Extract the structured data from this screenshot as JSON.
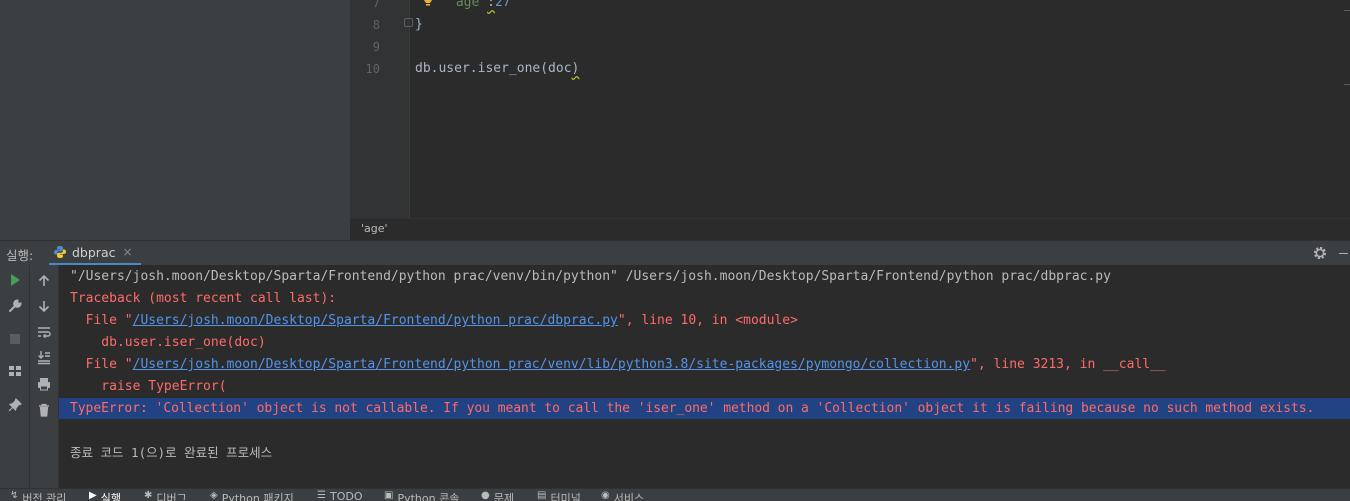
{
  "editor": {
    "lines": [
      {
        "num": "7",
        "code_key": "'age'",
        "code_sep": ":",
        "code_val": "27"
      },
      {
        "num": "8",
        "code": "}"
      },
      {
        "num": "9",
        "code": ""
      },
      {
        "num": "10",
        "code_prefix": "db.user.iser_one(doc",
        "code_suffix": ")"
      }
    ],
    "breadcrumb": "'age'"
  },
  "run_panel": {
    "label": "실행:",
    "tab_name": "dbprac",
    "tab_close": "×",
    "console": {
      "cmd_line": "\"/Users/josh.moon/Desktop/Sparta/Frontend/python prac/venv/bin/python\" /Users/josh.moon/Desktop/Sparta/Frontend/python prac/dbprac.py",
      "traceback": "Traceback (most recent call last):",
      "file1_prefix": "  File \"",
      "file1_link": "/Users/josh.moon/Desktop/Sparta/Frontend/python prac/dbprac.py",
      "file1_suffix": "\", line 10, in <module>",
      "code1": "    db.user.iser_one(doc)",
      "file2_prefix": "  File \"",
      "file2_link": "/Users/josh.moon/Desktop/Sparta/Frontend/python prac/venv/lib/python3.8/site-packages/pymongo/collection.py",
      "file2_suffix": "\", line 3213, in __call__",
      "code2": "    raise TypeError(",
      "error_line": "TypeError: 'Collection' object is not callable. If you meant to call the 'iser_one' method on a 'Collection' object it is failing because no such method exists.",
      "exit_line": "종료 코드 1(으)로 완료된 프로세스"
    }
  },
  "bottom_tabs": [
    {
      "icon": "version-control-icon",
      "glyph": "↯",
      "label": "버전 관리"
    },
    {
      "icon": "run-icon",
      "glyph": "▶",
      "label": "실행",
      "active": true
    },
    {
      "icon": "debug-icon",
      "glyph": "✱",
      "label": "디버그"
    },
    {
      "icon": "python-packages-icon",
      "glyph": "◈",
      "label": "Python 패키지"
    },
    {
      "icon": "todo-icon",
      "glyph": "☰",
      "label": "TODO"
    },
    {
      "icon": "python-console-icon",
      "glyph": "▣",
      "label": "Python 콘솔"
    },
    {
      "icon": "problems-icon",
      "glyph": "●",
      "label": "문제"
    },
    {
      "icon": "terminal-icon",
      "glyph": "▤",
      "label": "터미널"
    },
    {
      "icon": "services-icon",
      "glyph": "◉",
      "label": "서비스"
    }
  ],
  "colors": {
    "background": "#2b2b2b",
    "panel": "#3c3f41",
    "error_text": "#ff6b68",
    "link": "#5394ec",
    "selection": "#214283",
    "run_green": "#499c54"
  }
}
